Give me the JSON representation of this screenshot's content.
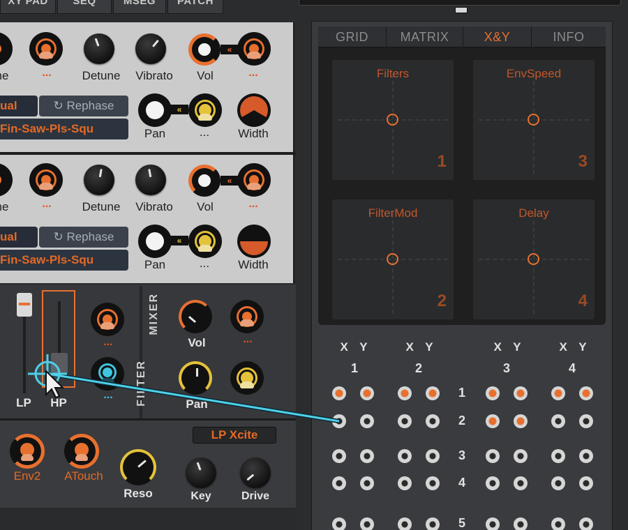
{
  "top_tabs": [
    "XY PAD",
    "SEQ",
    "MSEG",
    "PATCH"
  ],
  "osc1": {
    "knob_labels": [
      "ne",
      "Detune",
      "Vibrato",
      "Vol",
      "Pan",
      "Width"
    ],
    "mod_dots": "...",
    "mode_label": "ual",
    "rephase_label": "↻ Rephase",
    "wave_label": "Fin-Saw-Pls-Squ"
  },
  "osc2": {
    "knob_labels": [
      "ne",
      "Detune",
      "Vibrato",
      "Vol",
      "Pan",
      "Width"
    ],
    "mod_dots": "...",
    "mode_label": "ual",
    "rephase_label": "↻ Rephase",
    "wave_label": "Fin-Saw-Pls-Squ"
  },
  "filter": {
    "lp_label": "LP",
    "hp_label": "HP",
    "mixer_label": "MIXER",
    "filter_label": "FILTER",
    "vol_label": "Vol",
    "pan_label": "Pan",
    "dots": "..."
  },
  "env": {
    "env2_label": "Env2",
    "atouch_label": "ATouch",
    "reso_label": "Reso",
    "filter_type": "LP Xcite",
    "key_label": "Key",
    "drive_label": "Drive"
  },
  "right_tabs": [
    "GRID",
    "MATRIX",
    "X&Y",
    "INFO"
  ],
  "active_tab": "X&Y",
  "pads": [
    {
      "title": "Filters",
      "num": "1"
    },
    {
      "title": "EnvSpeed",
      "num": "3"
    },
    {
      "title": "FilterMod",
      "num": "2"
    },
    {
      "title": "Delay",
      "num": "4"
    }
  ],
  "matrix": {
    "xy_header": "X Y",
    "cols": [
      "1",
      "2",
      "3",
      "4"
    ],
    "rows": [
      "1",
      "2",
      "3",
      "4",
      "5"
    ]
  },
  "colors": {
    "accent": "#e8702f",
    "cyan": "#3fc6e0",
    "yellow": "#e4c23a"
  }
}
